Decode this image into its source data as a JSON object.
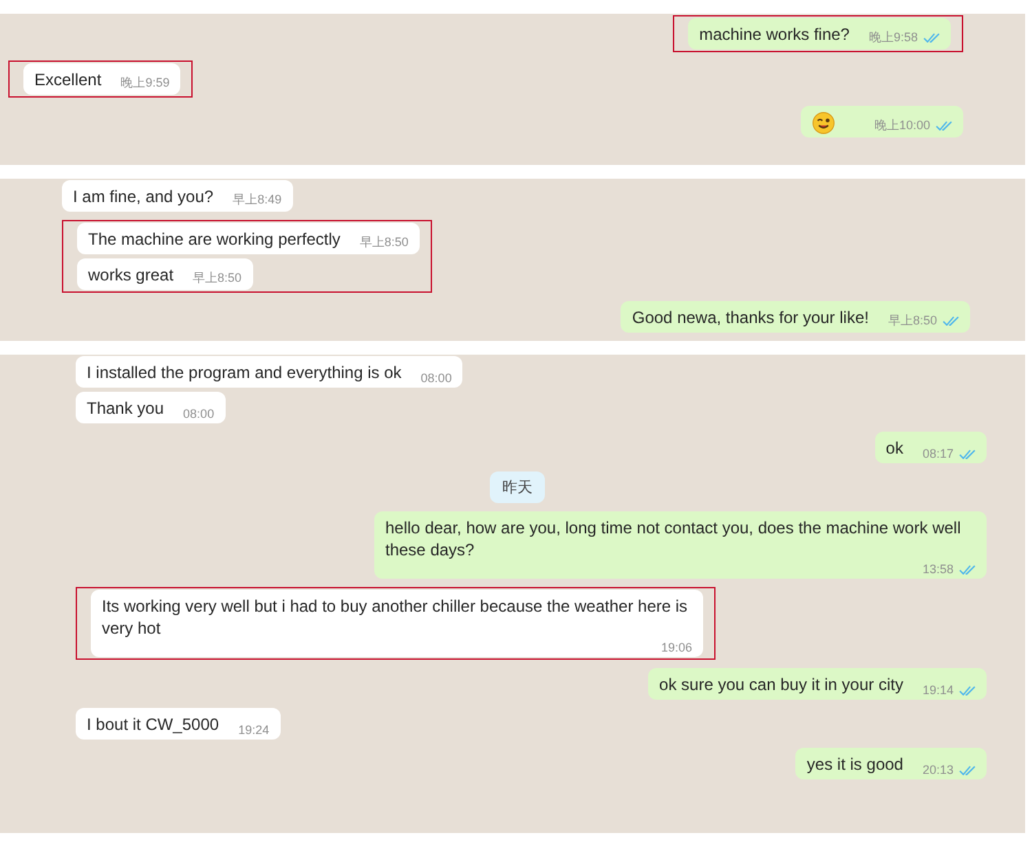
{
  "panels": [
    {
      "rows": [
        {
          "kind": "out",
          "highlighted": true,
          "messages": [
            {
              "kind": "text",
              "text": "machine works fine?",
              "time": "晚上9:58",
              "read": true
            }
          ]
        },
        {
          "kind": "in",
          "highlighted": true,
          "messages": [
            {
              "kind": "text",
              "text": "Excellent",
              "time": "晚上9:59",
              "read": false
            }
          ]
        },
        {
          "kind": "out",
          "highlighted": false,
          "messages": [
            {
              "kind": "emoji",
              "time": "晚上10:00",
              "read": true
            }
          ]
        }
      ]
    },
    {
      "rows": [
        {
          "kind": "in",
          "highlighted": false,
          "messages": [
            {
              "kind": "text",
              "text": "I am fine, and you?",
              "time": "早上8:49",
              "read": false
            }
          ]
        },
        {
          "kind": "in",
          "highlighted": true,
          "messages": [
            {
              "kind": "text",
              "text": "The machine are working perfectly",
              "time": "早上8:50",
              "read": false
            },
            {
              "kind": "text",
              "text": "works great",
              "time": "早上8:50",
              "read": false
            }
          ]
        },
        {
          "kind": "out",
          "highlighted": false,
          "messages": [
            {
              "kind": "text",
              "text": "Good newa, thanks for your like!",
              "time": "早上8:50",
              "read": true
            }
          ]
        }
      ]
    },
    {
      "rows": [
        {
          "kind": "in",
          "highlighted": false,
          "messages": [
            {
              "kind": "text",
              "text": "I installed the program and everything is ok",
              "time": "08:00",
              "read": false
            },
            {
              "kind": "text",
              "text": "Thank you",
              "time": "08:00",
              "read": false
            }
          ]
        },
        {
          "kind": "out",
          "highlighted": false,
          "messages": [
            {
              "kind": "text",
              "text": "ok",
              "time": "08:17",
              "read": true
            }
          ]
        },
        {
          "kind": "date",
          "highlighted": false,
          "text": "昨天"
        },
        {
          "kind": "out",
          "highlighted": false,
          "messages": [
            {
              "kind": "text",
              "text": "hello dear, how are you, long time not contact you, does the machine work well these days?",
              "time": "13:58",
              "read": true
            }
          ]
        },
        {
          "kind": "in",
          "highlighted": true,
          "messages": [
            {
              "kind": "text",
              "text": "Its working very well but i had to buy another chiller because the weather here is very hot",
              "time": "19:06",
              "read": false
            }
          ]
        },
        {
          "kind": "out",
          "highlighted": false,
          "messages": [
            {
              "kind": "text",
              "text": "ok sure you can buy it in your city",
              "time": "19:14",
              "read": true
            }
          ]
        },
        {
          "kind": "in",
          "highlighted": false,
          "messages": [
            {
              "kind": "text",
              "text": "I bout it CW_5000",
              "time": "19:24",
              "read": false
            }
          ]
        },
        {
          "kind": "out",
          "highlighted": false,
          "messages": [
            {
              "kind": "text",
              "text": "yes it is good",
              "time": "20:13",
              "read": true
            }
          ]
        }
      ]
    }
  ]
}
